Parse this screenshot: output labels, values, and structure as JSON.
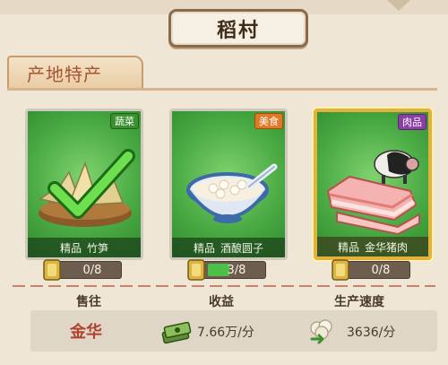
{
  "header": {
    "title": "稻村"
  },
  "section": {
    "title": "产地特产"
  },
  "products": [
    {
      "category": "蔬菜",
      "quality": "精品",
      "name": "竹笋",
      "progress_text": "0/8",
      "progress": 0.0,
      "completed": true,
      "tag_color": "#3a8f2e"
    },
    {
      "category": "美食",
      "quality": "精品",
      "name": "酒酿圆子",
      "progress_text": "3/8",
      "progress": 0.375,
      "completed": false,
      "tag_color": "#e07a26"
    },
    {
      "category": "肉品",
      "quality": "精品",
      "name": "金华猪肉",
      "progress_text": "0/8",
      "progress": 0.0,
      "completed": false,
      "tag_color": "#8a3fa6"
    }
  ],
  "info": {
    "sell_to_label": "售往",
    "income_label": "收益",
    "speed_label": "生产速度",
    "sell_to_value": "金华",
    "income_value": "7.66万/分",
    "speed_value": "3636/分"
  },
  "icons": {
    "coin": "coin-icon",
    "money": "money-stack-icon",
    "speed": "cotton-speed-icon",
    "check": "checkmark-icon"
  }
}
